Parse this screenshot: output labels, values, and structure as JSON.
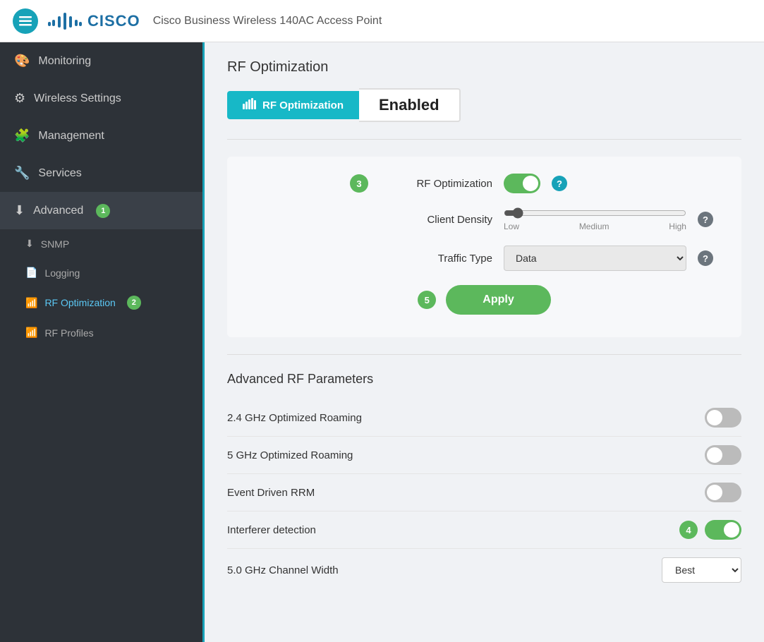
{
  "header": {
    "title": "Cisco Business Wireless 140AC Access Point",
    "logo_text": "CISCO"
  },
  "sidebar": {
    "items": [
      {
        "id": "monitoring",
        "label": "Monitoring",
        "icon": "🎨"
      },
      {
        "id": "wireless-settings",
        "label": "Wireless Settings",
        "icon": "⚙"
      },
      {
        "id": "management",
        "label": "Management",
        "icon": "🧩"
      },
      {
        "id": "services",
        "label": "Services",
        "icon": "🔧"
      },
      {
        "id": "advanced",
        "label": "Advanced",
        "icon": "⬇",
        "badge": "1"
      }
    ],
    "sub_items": [
      {
        "id": "snmp",
        "label": "SNMP",
        "icon": "⬇"
      },
      {
        "id": "logging",
        "label": "Logging",
        "icon": "📄"
      },
      {
        "id": "rf-optimization",
        "label": "RF Optimization",
        "icon": "📶",
        "badge": "2",
        "active": true
      },
      {
        "id": "rf-profiles",
        "label": "RF Profiles",
        "icon": "📶"
      }
    ]
  },
  "main": {
    "page_title": "RF Optimization",
    "tab_label": "RF Optimization",
    "tab_status": "Enabled",
    "form": {
      "step3_badge": "3",
      "rf_optimization_label": "RF Optimization",
      "client_density_label": "Client Density",
      "client_density_low": "Low",
      "client_density_medium": "Medium",
      "client_density_high": "High",
      "traffic_type_label": "Traffic Type",
      "traffic_type_value": "Data",
      "step5_badge": "5",
      "apply_label": "Apply"
    },
    "advanced": {
      "title": "Advanced RF Parameters",
      "rows": [
        {
          "label": "2.4 GHz Optimized Roaming",
          "type": "toggle",
          "value": false
        },
        {
          "label": "5 GHz Optimized Roaming",
          "type": "toggle",
          "value": false
        },
        {
          "label": "Event Driven RRM",
          "type": "toggle",
          "value": false
        },
        {
          "label": "Interferer detection",
          "type": "toggle",
          "value": true,
          "badge": "4"
        },
        {
          "label": "5.0 GHz Channel Width",
          "type": "select",
          "value": "Best"
        }
      ]
    }
  }
}
